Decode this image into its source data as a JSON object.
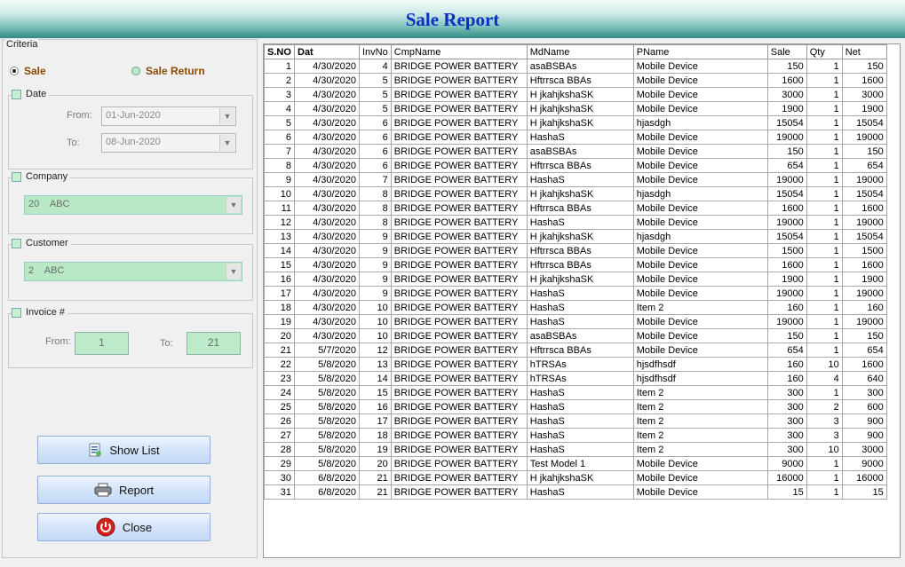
{
  "header": {
    "title": "Sale Report"
  },
  "criteria": {
    "legend": "Criteria",
    "sale_label": "Sale",
    "sale_return_label": "Sale Return",
    "date": {
      "label": "Date",
      "from_label": "From:",
      "from_value": "01-Jun-2020",
      "to_label": "To:",
      "to_value": "08-Jun-2020"
    },
    "company": {
      "label": "Company",
      "value": "20    ABC"
    },
    "customer": {
      "label": "Customer",
      "value": "2    ABC"
    },
    "invoice": {
      "label": "Invoice #",
      "from_label": "From:",
      "from_value": "1",
      "to_label": "To:",
      "to_value": "21"
    }
  },
  "buttons": {
    "show_list": "Show List",
    "report": "Report",
    "close": "Close"
  },
  "grid": {
    "columns": [
      "S.NO",
      "Dat",
      "InvNo",
      "CmpName",
      "MdName",
      "PName",
      "Sale",
      "Qty",
      "Net"
    ],
    "rows": [
      [
        "1",
        "4/30/2020",
        "4",
        "BRIDGE POWER BATTERY",
        "asaBSBAs",
        "Mobile Device",
        "150",
        "1",
        "150"
      ],
      [
        "2",
        "4/30/2020",
        "5",
        "BRIDGE POWER BATTERY",
        "Hftrrsca BBAs",
        "Mobile Device",
        "1600",
        "1",
        "1600"
      ],
      [
        "3",
        "4/30/2020",
        "5",
        "BRIDGE POWER BATTERY",
        "H jkahjkshaSK",
        "Mobile Device",
        "3000",
        "1",
        "3000"
      ],
      [
        "4",
        "4/30/2020",
        "5",
        "BRIDGE POWER BATTERY",
        "H jkahjkshaSK",
        "Mobile Device",
        "1900",
        "1",
        "1900"
      ],
      [
        "5",
        "4/30/2020",
        "6",
        "BRIDGE POWER BATTERY",
        "H jkahjkshaSK",
        "hjasdgh",
        "15054",
        "1",
        "15054"
      ],
      [
        "6",
        "4/30/2020",
        "6",
        "BRIDGE POWER BATTERY",
        "HashaS",
        "Mobile Device",
        "19000",
        "1",
        "19000"
      ],
      [
        "7",
        "4/30/2020",
        "6",
        "BRIDGE POWER BATTERY",
        "asaBSBAs",
        "Mobile Device",
        "150",
        "1",
        "150"
      ],
      [
        "8",
        "4/30/2020",
        "6",
        "BRIDGE POWER BATTERY",
        "Hftrrsca BBAs",
        "Mobile Device",
        "654",
        "1",
        "654"
      ],
      [
        "9",
        "4/30/2020",
        "7",
        "BRIDGE POWER BATTERY",
        "HashaS",
        "Mobile Device",
        "19000",
        "1",
        "19000"
      ],
      [
        "10",
        "4/30/2020",
        "8",
        "BRIDGE POWER BATTERY",
        "H jkahjkshaSK",
        "hjasdgh",
        "15054",
        "1",
        "15054"
      ],
      [
        "11",
        "4/30/2020",
        "8",
        "BRIDGE POWER BATTERY",
        "Hftrrsca BBAs",
        "Mobile Device",
        "1600",
        "1",
        "1600"
      ],
      [
        "12",
        "4/30/2020",
        "8",
        "BRIDGE POWER BATTERY",
        "HashaS",
        "Mobile Device",
        "19000",
        "1",
        "19000"
      ],
      [
        "13",
        "4/30/2020",
        "9",
        "BRIDGE POWER BATTERY",
        "H jkahjkshaSK",
        "hjasdgh",
        "15054",
        "1",
        "15054"
      ],
      [
        "14",
        "4/30/2020",
        "9",
        "BRIDGE POWER BATTERY",
        "Hftrrsca BBAs",
        "Mobile Device",
        "1500",
        "1",
        "1500"
      ],
      [
        "15",
        "4/30/2020",
        "9",
        "BRIDGE POWER BATTERY",
        "Hftrrsca BBAs",
        "Mobile Device",
        "1600",
        "1",
        "1600"
      ],
      [
        "16",
        "4/30/2020",
        "9",
        "BRIDGE POWER BATTERY",
        "H jkahjkshaSK",
        "Mobile Device",
        "1900",
        "1",
        "1900"
      ],
      [
        "17",
        "4/30/2020",
        "9",
        "BRIDGE POWER BATTERY",
        "HashaS",
        "Mobile Device",
        "19000",
        "1",
        "19000"
      ],
      [
        "18",
        "4/30/2020",
        "10",
        "BRIDGE POWER BATTERY",
        "HashaS",
        "Item 2",
        "160",
        "1",
        "160"
      ],
      [
        "19",
        "4/30/2020",
        "10",
        "BRIDGE POWER BATTERY",
        "HashaS",
        "Mobile Device",
        "19000",
        "1",
        "19000"
      ],
      [
        "20",
        "4/30/2020",
        "10",
        "BRIDGE POWER BATTERY",
        "asaBSBAs",
        "Mobile Device",
        "150",
        "1",
        "150"
      ],
      [
        "21",
        "5/7/2020",
        "12",
        "BRIDGE POWER BATTERY",
        "Hftrrsca BBAs",
        "Mobile Device",
        "654",
        "1",
        "654"
      ],
      [
        "22",
        "5/8/2020",
        "13",
        "BRIDGE POWER BATTERY",
        "hTRSAs",
        "hjsdfhsdf",
        "160",
        "10",
        "1600"
      ],
      [
        "23",
        "5/8/2020",
        "14",
        "BRIDGE POWER BATTERY",
        "hTRSAs",
        "hjsdfhsdf",
        "160",
        "4",
        "640"
      ],
      [
        "24",
        "5/8/2020",
        "15",
        "BRIDGE POWER BATTERY",
        "HashaS",
        "Item 2",
        "300",
        "1",
        "300"
      ],
      [
        "25",
        "5/8/2020",
        "16",
        "BRIDGE POWER BATTERY",
        "HashaS",
        "Item 2",
        "300",
        "2",
        "600"
      ],
      [
        "26",
        "5/8/2020",
        "17",
        "BRIDGE POWER BATTERY",
        "HashaS",
        "Item 2",
        "300",
        "3",
        "900"
      ],
      [
        "27",
        "5/8/2020",
        "18",
        "BRIDGE POWER BATTERY",
        "HashaS",
        "Item 2",
        "300",
        "3",
        "900"
      ],
      [
        "28",
        "5/8/2020",
        "19",
        "BRIDGE POWER BATTERY",
        "HashaS",
        "Item 2",
        "300",
        "10",
        "3000"
      ],
      [
        "29",
        "5/8/2020",
        "20",
        "BRIDGE POWER BATTERY",
        "Test Model 1",
        "Mobile Device",
        "9000",
        "1",
        "9000"
      ],
      [
        "30",
        "6/8/2020",
        "21",
        "BRIDGE POWER BATTERY",
        "H jkahjkshaSK",
        "Mobile Device",
        "16000",
        "1",
        "16000"
      ],
      [
        "31",
        "6/8/2020",
        "21",
        "BRIDGE POWER BATTERY",
        "HashaS",
        "Mobile Device",
        "15",
        "1",
        "15"
      ]
    ]
  },
  "icons": {
    "show_list": "list-icon",
    "report": "printer-icon",
    "close": "power-icon"
  },
  "colors": {
    "title": "#0a2fc2",
    "header_teal": "#2f8b83",
    "field_green": "#bdebc9",
    "button_blue": "#d4e4fb",
    "close_red": "#d62020"
  }
}
